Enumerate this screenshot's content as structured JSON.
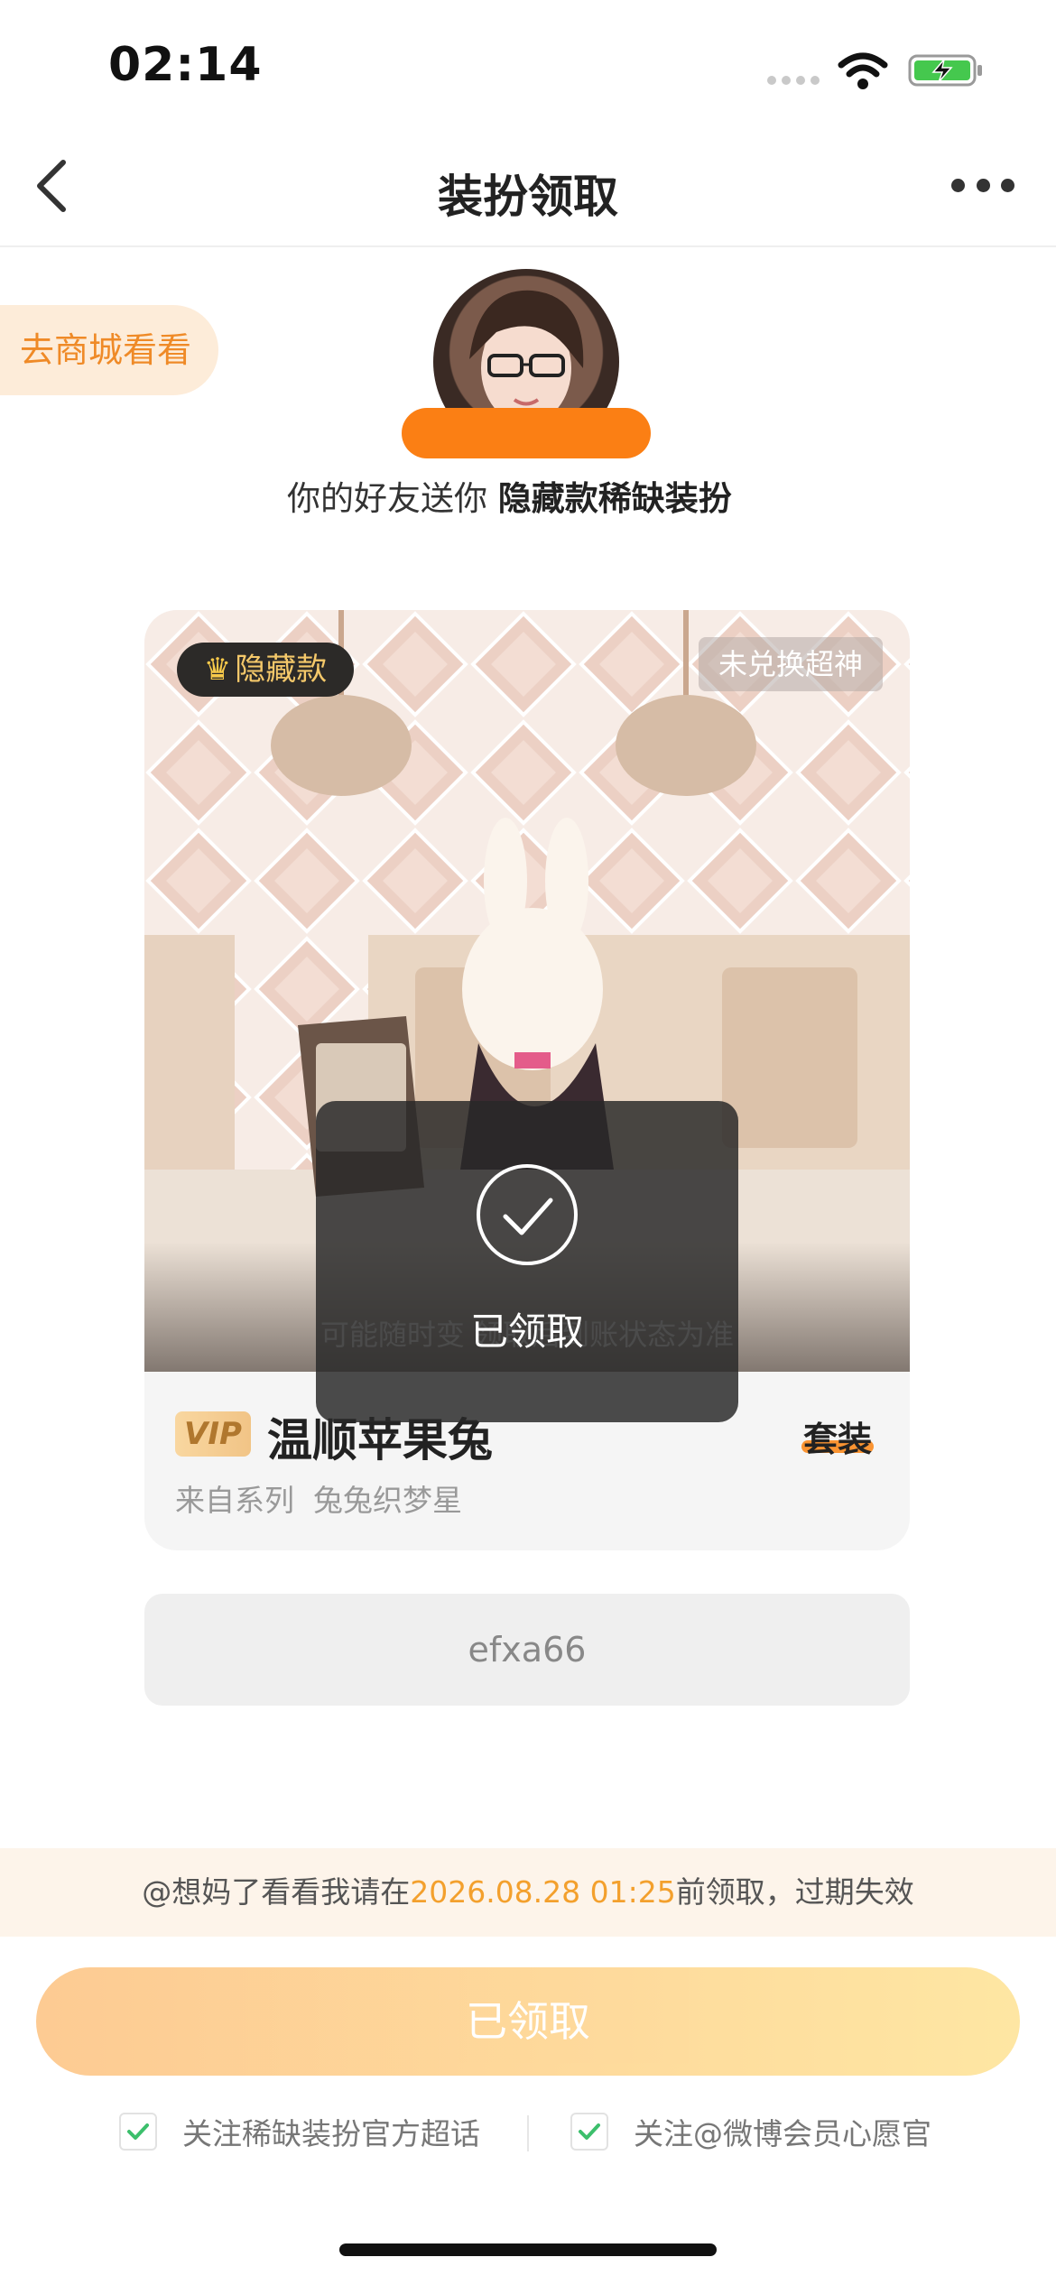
{
  "status_bar": {
    "time": "02:14"
  },
  "nav": {
    "title": "装扮领取"
  },
  "shop_link": {
    "label": "去商城看看"
  },
  "gift": {
    "prefix": "你的好友送你 ",
    "highlight": "隐藏款稀缺装扮"
  },
  "card": {
    "tag_hidden": "隐藏款",
    "tag_status": "未兑换超神",
    "image_notice": "可能随时变    领取后到账状态为准",
    "vip_label": "VIP",
    "item_name": "温顺苹果兔",
    "set_label": "套装",
    "series_label": "来自系列",
    "series_name": "兔兔织梦星"
  },
  "code": {
    "value": "efxa66"
  },
  "toast": {
    "text": "已领取"
  },
  "deadline": {
    "prefix": "@想妈了看看我请在",
    "datetime": "2026.08.28 01:25",
    "suffix": "前领取，过期失效"
  },
  "claim_button": {
    "label": "已领取"
  },
  "follows": [
    {
      "label": "关注稀缺装扮官方超话",
      "checked": true
    },
    {
      "label": "关注@微博会员心愿官",
      "checked": true
    }
  ],
  "colors": {
    "accent": "#fb8a1d",
    "check": "#3cbf6c",
    "highlight": "#f3a02d"
  }
}
